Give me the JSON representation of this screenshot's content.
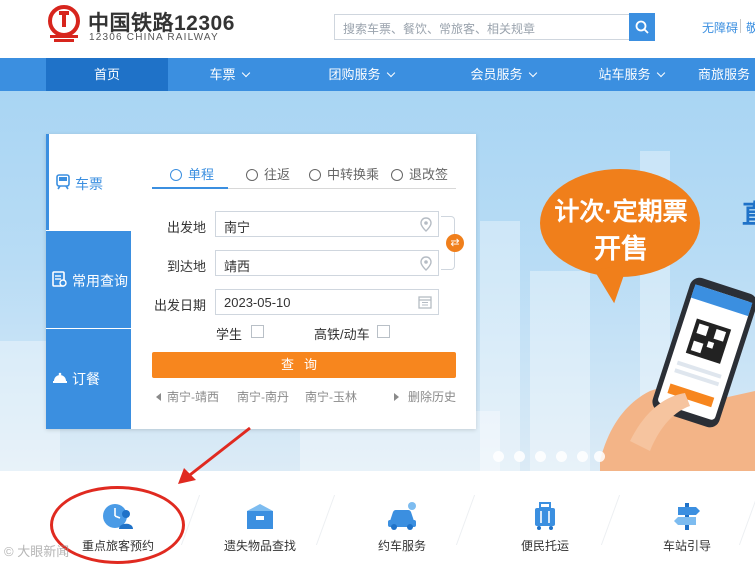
{
  "header": {
    "logo_cn": "中国铁路12306",
    "logo_en": "12306 CHINA RAILWAY",
    "search_placeholder": "搜索车票、餐饮、常旅客、相关规章",
    "link_accessibility": "无障碍",
    "link_b": "敬"
  },
  "nav": {
    "items": [
      {
        "label": "首页",
        "active": true
      },
      {
        "label": "车票",
        "dropdown": true
      },
      {
        "label": "团购服务",
        "dropdown": true
      },
      {
        "label": "会员服务",
        "dropdown": true
      },
      {
        "label": "站车服务",
        "dropdown": true
      },
      {
        "label": "商旅服务",
        "dropdown": false
      }
    ]
  },
  "banner": {
    "bubble_line1": "计次·定期票",
    "bubble_line2": "开售",
    "edge_text": "直",
    "slide_count": 6
  },
  "widget": {
    "side_tabs": [
      {
        "label": "车票",
        "icon": "train-icon"
      },
      {
        "label": "常用查询",
        "icon": "query-icon"
      },
      {
        "label": "订餐",
        "icon": "meal-icon"
      }
    ],
    "trip_tabs": [
      {
        "label": "单程"
      },
      {
        "label": "往返"
      },
      {
        "label": "中转换乘"
      },
      {
        "label": "退改签"
      }
    ],
    "from_label": "出发地",
    "from_value": "南宁",
    "to_label": "到达地",
    "to_value": "靖西",
    "date_label": "出发日期",
    "date_value": "2023-05-10",
    "student_label": "学生",
    "highspeed_label": "高铁/动车",
    "query_label": "查询",
    "history": [
      "南宁-靖西",
      "南宁-南丹",
      "南宁-玉林"
    ],
    "clear_history": "删除历史"
  },
  "services": [
    {
      "label": "重点旅客预约",
      "icon": "priority-passenger-icon"
    },
    {
      "label": "遗失物品查找",
      "icon": "lost-found-icon"
    },
    {
      "label": "约车服务",
      "icon": "car-icon"
    },
    {
      "label": "便民托运",
      "icon": "luggage-icon"
    },
    {
      "label": "车站引导",
      "icon": "signpost-icon"
    }
  ],
  "watermark": "大眼新闻",
  "colors": {
    "primary": "#3b8fe0",
    "nav_active": "#1f72c8",
    "accent_orange": "#f7861e",
    "annotation_red": "#e02a20"
  }
}
